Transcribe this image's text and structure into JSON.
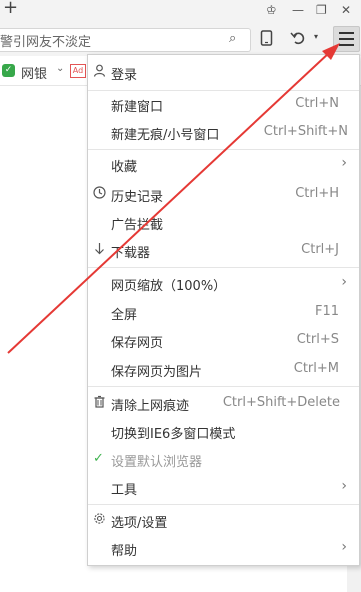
{
  "titlebar": {
    "new_tab_glyph": "+",
    "skin_glyph": "♔",
    "min_glyph": "—",
    "restore_glyph": "❐",
    "close_glyph": "✕"
  },
  "address": {
    "text": "警引网友不淡定",
    "search_glyph": "⌕"
  },
  "toolbar": {
    "phone_icon": "phone-icon",
    "undo_icon": "undo-icon",
    "menu_icon": "hamburger-menu-icon"
  },
  "bookmarks": {
    "shield_label": "网银",
    "shield_glyph": "✓",
    "chevron": "⌄",
    "ad_text": "Ad"
  },
  "menu": {
    "login": "登录",
    "new_window": "新建窗口",
    "new_window_key": "Ctrl+N",
    "new_incognito": "新建无痕/小号窗口",
    "new_incognito_key": "Ctrl+Shift+N",
    "favorites": "收藏",
    "history": "历史记录",
    "history_key": "Ctrl+H",
    "ad_block": "广告拦截",
    "downloader": "下载器",
    "downloader_key": "Ctrl+J",
    "zoom": "网页缩放（100%）",
    "fullscreen": "全屏",
    "fullscreen_key": "F11",
    "save_page": "保存网页",
    "save_page_key": "Ctrl+S",
    "save_as_image": "保存网页为图片",
    "save_as_image_key": "Ctrl+M",
    "clear_traces": "清除上网痕迹",
    "clear_traces_key": "Ctrl+Shift+Delete",
    "ie6_mode": "切换到IE6多窗口模式",
    "set_default": "设置默认浏览器",
    "tools": "工具",
    "options": "选项/设置",
    "help": "帮助",
    "submenu_glyph": "›"
  },
  "colors": {
    "annotation_arrow": "#e53935",
    "check": "#3fb34f"
  }
}
